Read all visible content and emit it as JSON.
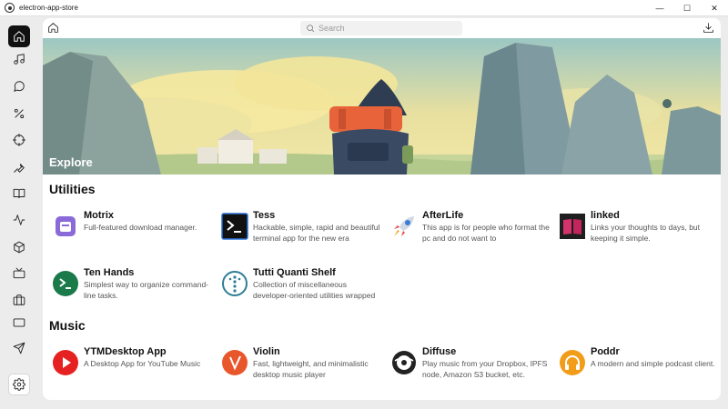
{
  "window": {
    "title": "electron-app-store",
    "minimize": "—",
    "maximize": "☐",
    "close": "✕"
  },
  "search": {
    "placeholder": "Search"
  },
  "banner": {
    "title": "Explore"
  },
  "sections": [
    {
      "title": "Utilities",
      "apps": [
        {
          "name": "Motrix",
          "desc": "Full-featured download manager.",
          "icon": "motrix-icon"
        },
        {
          "name": "Tess",
          "desc": "Hackable, simple, rapid and beautiful terminal app for the new era",
          "icon": "terminal-icon"
        },
        {
          "name": "AfterLife",
          "desc": "This app is for people who format the pc and do not want to",
          "icon": "rocket-icon"
        },
        {
          "name": "linked",
          "desc": "Links your thoughts to days, but keeping it simple.",
          "icon": "book-icon"
        },
        {
          "name": "Ten Hands",
          "desc": "Simplest way to organize command-line tasks.",
          "icon": "prompt-icon"
        },
        {
          "name": "Tutti Quanti Shelf",
          "desc": "Collection of miscellaneous developer-oriented utilities wrapped",
          "icon": "dots-icon"
        }
      ]
    },
    {
      "title": "Music",
      "apps": [
        {
          "name": "YTMDesktop App",
          "desc": "A Desktop App for YouTube Music",
          "icon": "play-icon"
        },
        {
          "name": "Violin",
          "desc": "Fast, lightweight, and minimalistic desktop music player",
          "icon": "violin-icon"
        },
        {
          "name": "Diffuse",
          "desc": "Play music from your Dropbox, IPFS node, Amazon S3 bucket, etc.",
          "icon": "diffuse-icon"
        },
        {
          "name": "Poddr",
          "desc": "A modern and simple podcast client.",
          "icon": "headphones-icon"
        }
      ]
    }
  ],
  "sidebar": {
    "items": [
      "home-icon",
      "music-icon",
      "chat-icon",
      "percent-icon",
      "crosshair-icon",
      "wrench-icon",
      "book-open-icon",
      "activity-icon",
      "cube-icon",
      "tv-icon",
      "briefcase-icon",
      "monitor-icon",
      "send-icon",
      "settings-icon"
    ]
  },
  "colors": {
    "accent": "#111111",
    "panel": "#ffffff",
    "background": "#ececec"
  }
}
